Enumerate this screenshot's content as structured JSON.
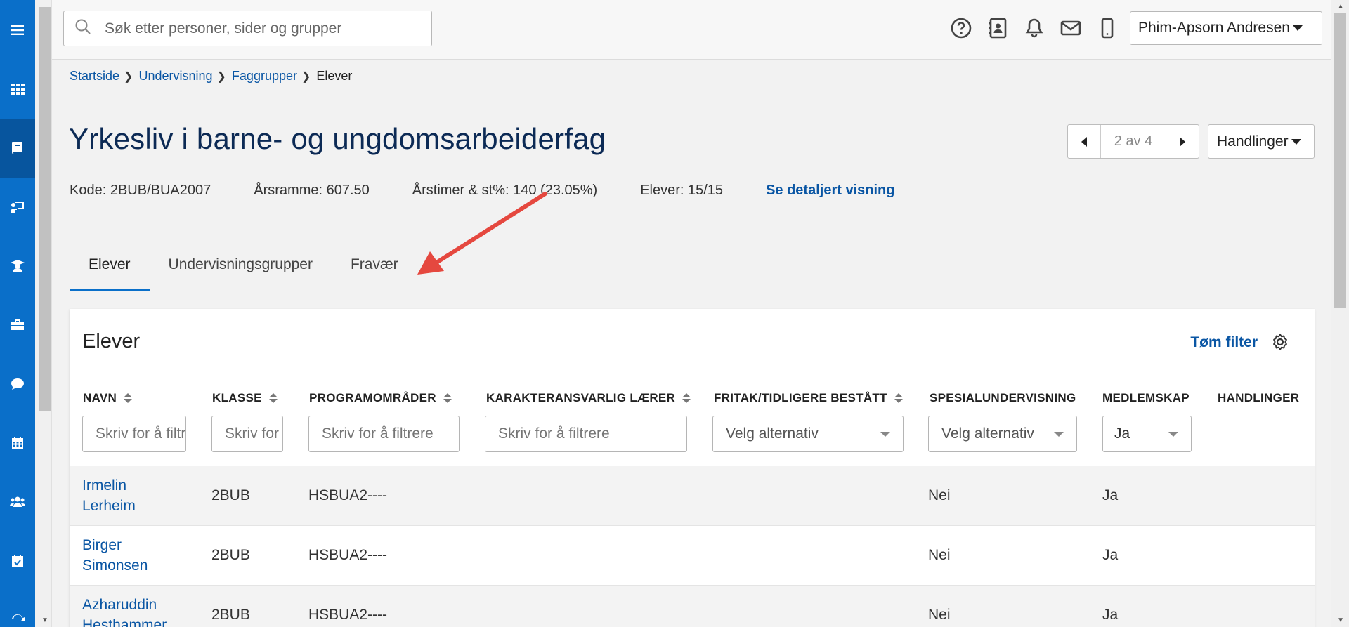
{
  "search": {
    "placeholder": "Søk etter personer, sider og grupper"
  },
  "user": {
    "name": "Phim-Apsorn Andresen"
  },
  "breadcrumb": {
    "items": [
      "Startside",
      "Undervisning",
      "Faggrupper"
    ],
    "current": "Elever"
  },
  "page": {
    "title": "Yrkesliv i barne- og ungdomsarbeiderfag",
    "pager": "2 av 4",
    "actions_label": "Handlinger"
  },
  "meta": {
    "kode": "Kode: 2BUB/BUA2007",
    "arsramme": "Årsramme: 607.50",
    "arstimer": "Årstimer & st%: 140 (23.05%)",
    "elever": "Elever: 15/15",
    "detail_link": "Se detaljert visning"
  },
  "tabs": [
    {
      "label": "Elever",
      "active": true
    },
    {
      "label": "Undervisningsgrupper",
      "active": false
    },
    {
      "label": "Fravær",
      "active": false
    }
  ],
  "panel": {
    "title": "Elever",
    "clear_filter": "Tøm filter",
    "columns": [
      "NAVN",
      "KLASSE",
      "PROGRAMOMRÅDER",
      "KARAKTERANSVARLIG LÆRER",
      "FRITAK/TIDLIGERE BESTÅTT",
      "SPESIALUNDERVISNING",
      "MEDLEMSKAP",
      "HANDLINGER"
    ],
    "filters": {
      "navn": "Skriv for å filtrere",
      "klasse": "Skriv for å filtrere",
      "programomrader": "Skriv for å filtrere",
      "larer": "Skriv for å filtrere",
      "fritak": "Velg alternativ",
      "spesial": "Velg alternativ",
      "medlemskap": "Ja"
    },
    "rows": [
      {
        "name_first": "Irmelin",
        "name_last": "Lerheim",
        "klasse": "2BUB",
        "program": "HSBUA2----",
        "spesial": "Nei",
        "medlemskap": "Ja"
      },
      {
        "name_first": "Birger",
        "name_last": "Simonsen",
        "klasse": "2BUB",
        "program": "HSBUA2----",
        "spesial": "Nei",
        "medlemskap": "Ja"
      },
      {
        "name_first": "Azharuddin",
        "name_last": "Hesthammer",
        "klasse": "2BUB",
        "program": "HSBUA2----",
        "spesial": "Nei",
        "medlemskap": "Ja"
      }
    ]
  },
  "colors": {
    "sidebar": "#0a6fc9",
    "link": "#0a56a4",
    "title": "#0c2a55",
    "annotation": "#e5483f"
  },
  "icons": {
    "sidebar": [
      "menu-icon",
      "apps-grid-icon",
      "book-icon",
      "teacher-board-icon",
      "graduate-icon",
      "briefcase-icon",
      "chat-icon",
      "calendar-icon",
      "people-icon",
      "calendar-check-icon",
      "sync-icon"
    ],
    "topbar": [
      "help-icon",
      "contacts-icon",
      "bell-icon",
      "mail-icon",
      "mobile-icon"
    ]
  }
}
